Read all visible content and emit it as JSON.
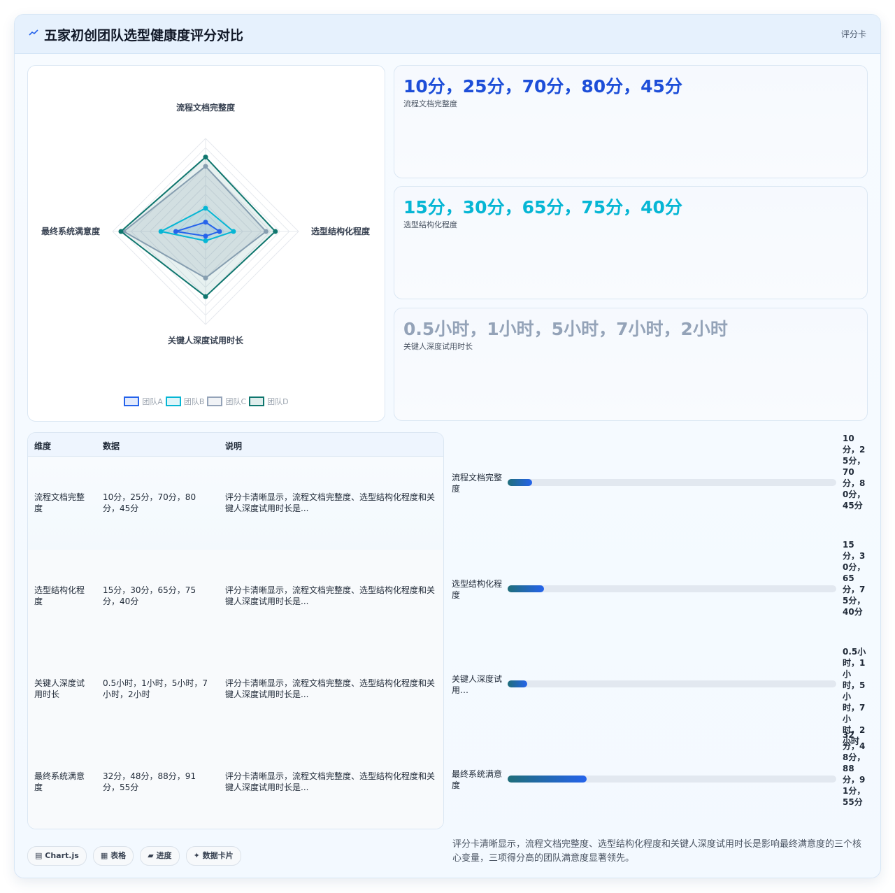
{
  "header": {
    "title": "五家初创团队选型健康度评分对比",
    "tag": "评分卡",
    "icon": "sparkline-icon"
  },
  "chart_data": {
    "type": "radar",
    "axes": [
      "流程文档完整度",
      "选型结构化程度",
      "关键人深度试用时长",
      "最终系统满意度"
    ],
    "axis_max": [
      100,
      100,
      10,
      100
    ],
    "grid": true,
    "legend_position": "bottom",
    "series": [
      {
        "name": "团队A",
        "values": [
          10,
          15,
          0.5,
          32
        ],
        "color": "#2563eb"
      },
      {
        "name": "团队B",
        "values": [
          25,
          30,
          1,
          48
        ],
        "color": "#06b6d4"
      },
      {
        "name": "团队C",
        "values": [
          70,
          65,
          5,
          88
        ],
        "color": "#94a3b8"
      },
      {
        "name": "团队D",
        "values": [
          80,
          75,
          7,
          91
        ],
        "color": "#0f766e"
      }
    ]
  },
  "cards": [
    {
      "value": "10分，25分，70分，80分，45分",
      "label": "流程文档完整度",
      "color": "#1d4ed8"
    },
    {
      "value": "15分，30分，65分，75分，40分",
      "label": "选型结构化程度",
      "color": "#06b6d4"
    },
    {
      "value": "0.5小时，1小时，5小时，7小时，2小时",
      "label": "关键人深度试用时长",
      "color": "#94a3b8"
    }
  ],
  "table": {
    "headers": [
      "维度",
      "数据",
      "说明"
    ],
    "rows": [
      {
        "dim": "流程文档完整度",
        "data": "10分，25分，70分，80分，45分",
        "desc": "评分卡清晰显示，流程文档完整度、选型结构化程度和关键人深度试用时长是..."
      },
      {
        "dim": "选型结构化程度",
        "data": "15分，30分，65分，75分，40分",
        "desc": "评分卡清晰显示，流程文档完整度、选型结构化程度和关键人深度试用时长是..."
      },
      {
        "dim": "关键人深度试用时长",
        "data": "0.5小时，1小时，5小时，7小时，2小时",
        "desc": "评分卡清晰显示，流程文档完整度、选型结构化程度和关键人深度试用时长是..."
      },
      {
        "dim": "最终系统满意度",
        "data": "32分，48分，88分，91分，55分",
        "desc": "评分卡清晰显示，流程文档完整度、选型结构化程度和关键人深度试用时长是..."
      }
    ]
  },
  "progress": [
    {
      "label": "流程文档完整度",
      "value": "10分，25分，70分，80分，45分",
      "percent": 7.5
    },
    {
      "label": "选型结构化程度",
      "value": "15分，30分，65分，75分，40分",
      "percent": 11
    },
    {
      "label": "关键人深度试用…",
      "value": "0.5小时，1小时，5小时，7小时，2小时",
      "percent": 6
    },
    {
      "label": "最终系统满意度",
      "value": "32分，48分，88分，91分，55分",
      "percent": 24
    }
  ],
  "pills": [
    {
      "icon": "chart-icon",
      "glyph": "▤",
      "label": "Chart.js"
    },
    {
      "icon": "table-icon",
      "glyph": "▦",
      "label": "表格"
    },
    {
      "icon": "progress-icon",
      "glyph": "▰",
      "label": "进度"
    },
    {
      "icon": "sparkle-icon",
      "glyph": "✦",
      "label": "数据卡片"
    }
  ],
  "note": "评分卡清晰显示，流程文档完整度、选型结构化程度和关键人深度试用时长是影响最终满意度的三个核心变量，三项得分高的团队满意度显著领先。"
}
